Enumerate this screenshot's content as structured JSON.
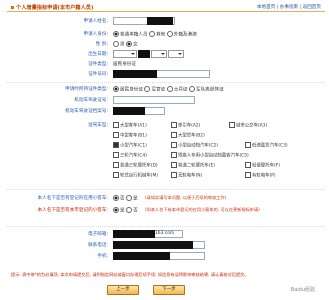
{
  "header": {
    "title": "个人增量指标申请(本市户籍人员)",
    "links": "本地首页 | 办事指南 | 返回首页"
  },
  "form": {
    "applicant_name_label": "申请人姓名:",
    "identity_label": "申请人身份:",
    "identity_options": [
      "普通本籍人员",
      "其他",
      "外籍及港澳"
    ],
    "gender_label": "性    别:",
    "gender_options": [
      "男",
      "女"
    ],
    "birth_label": "出生日期:",
    "id_type_label": "证件类型:",
    "id_type_value": "居民身份证",
    "id_number_label": "证件号码:",
    "license_type_label": "申请时所持证件类型:",
    "license_type_options": [
      "居民身份证",
      "军官证",
      "士兵证",
      "军队离退休证"
    ],
    "license_num_label": "机动车驾驶证号:",
    "license_file_label": "机动车驾驶证档案号:",
    "license_class_label": "准驾车型:",
    "vehicle_classes": [
      {
        "label": "大型客车(A1)",
        "checked": false
      },
      {
        "label": "牵引车(A2)",
        "checked": false
      },
      {
        "label": "城市公交车(A3)",
        "checked": false
      },
      {
        "label": "中型客车(B1)",
        "checked": false
      },
      {
        "label": "大型货车(B2)",
        "checked": false
      },
      {
        "label": "小型汽车(C1)",
        "checked": true
      },
      {
        "label": "小型自动挡汽车(C2)",
        "checked": false
      },
      {
        "label": "低速载货汽车(C3)",
        "checked": false
      },
      {
        "label": "三轮汽车(C4)",
        "checked": false
      },
      {
        "label": "残疾人专用小型自动挡载客汽车(C5)",
        "checked": false
      },
      {
        "label": "普通三轮摩托车(D)",
        "checked": false
      },
      {
        "label": "普通二轮摩托车(E)",
        "checked": false
      },
      {
        "label": "轻便摩托车(F)",
        "checked": false
      },
      {
        "label": "轮式自行机械车(M)",
        "checked": false
      },
      {
        "label": "无轨电车(N)",
        "checked": false
      },
      {
        "label": "有轨电车(P)",
        "checked": false
      }
    ],
    "has_vehicle_label": "本人名下是否有登记的在用小客车:",
    "has_vehicle_options": [
      "否",
      "是"
    ],
    "has_vehicle_hint": "(请如实填写本问题, 以便于后续的审核工作)",
    "local_vehicle_label": "本人名下是否有本市登记的小客车:",
    "local_vehicle_options": [
      "是",
      "否"
    ],
    "local_vehicle_hint": "(如本人名下有本市登记的在用小客车的, 可以在更新指标申请)",
    "email_label": "电子邮箱:",
    "email_value": "163.com",
    "phone_label": "联系电话:",
    "mobile_label": "手机:",
    "note": "提示: 表中带*的为必填项, 本次申请提交后, 请到指定网站或窗口办理后续手续; 如信息有误将影响审核结果, 请认真核对后提交。",
    "prev_button": "上一步",
    "next_button": "下一步"
  },
  "watermark": "Baidu经验",
  "colors": {
    "label": "#2b5db8",
    "warning": "#cc2200",
    "accent": "#e07000"
  }
}
